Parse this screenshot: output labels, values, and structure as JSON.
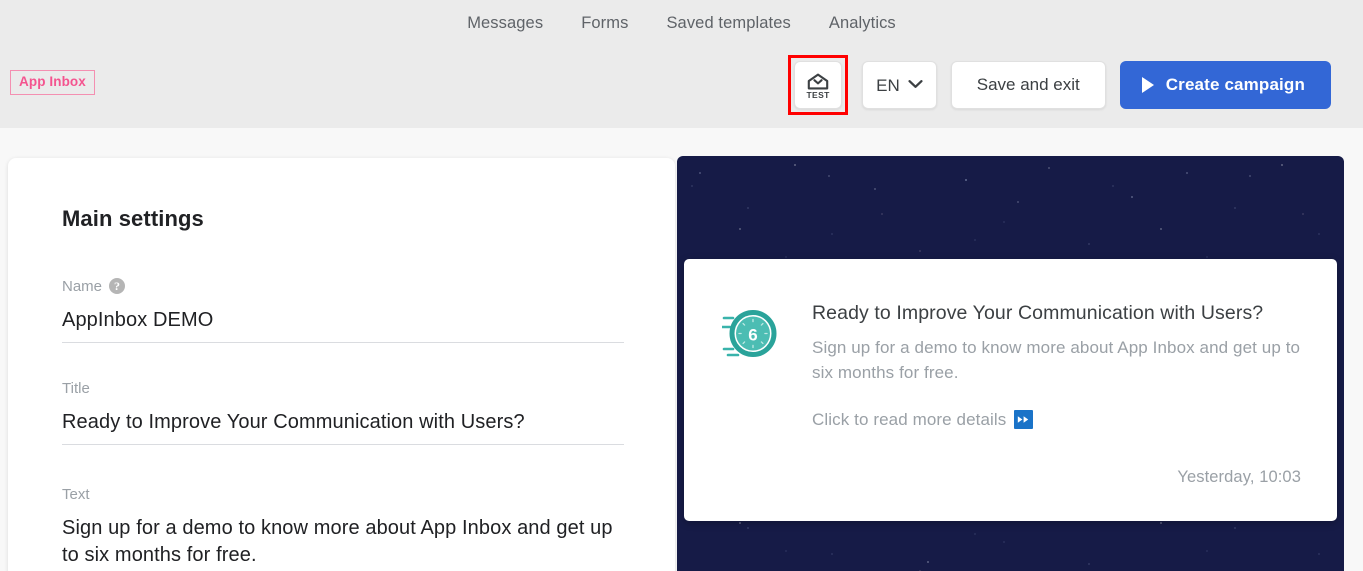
{
  "header": {
    "nav_tabs": [
      {
        "label": "Messages"
      },
      {
        "label": "Forms"
      },
      {
        "label": "Saved templates"
      },
      {
        "label": "Analytics"
      }
    ],
    "channel_badge": "App Inbox",
    "test_button": {
      "label": "TEST",
      "icon": "home-test-icon"
    },
    "language": {
      "code": "EN",
      "chevron": "chevron-down-icon"
    },
    "save_and_exit": "Save and exit",
    "create_campaign": "Create campaign",
    "colors": {
      "badge_accent": "#f4548f",
      "primary_button": "#3367d6",
      "highlight_annotation": "#ff0000",
      "header_background": "#ebebeb"
    }
  },
  "settings": {
    "card_title": "Main settings",
    "fields": [
      {
        "label": "Name",
        "has_help": true,
        "help_glyph": "?",
        "value": "AppInbox DEMO"
      },
      {
        "label": "Title",
        "has_help": false,
        "value": "Ready to Improve Your Communication with Users?"
      },
      {
        "label": "Text",
        "has_help": false,
        "value": "Sign up for a demo to know more about App Inbox and get up to six months for free."
      }
    ]
  },
  "preview": {
    "background": "starfield",
    "background_color": "#161b47",
    "message": {
      "avatar_icon": "clock-icon",
      "avatar_number": "6",
      "avatar_color": "#2aa39a",
      "title": "Ready to Improve Your Communication with Users?",
      "text": "Sign up for a demo to know more about App Inbox and get up to six months for free.",
      "cta_label": "Click to read more details",
      "cta_icon": "fast-forward-icon",
      "timestamp": "Yesterday, 10:03"
    }
  }
}
